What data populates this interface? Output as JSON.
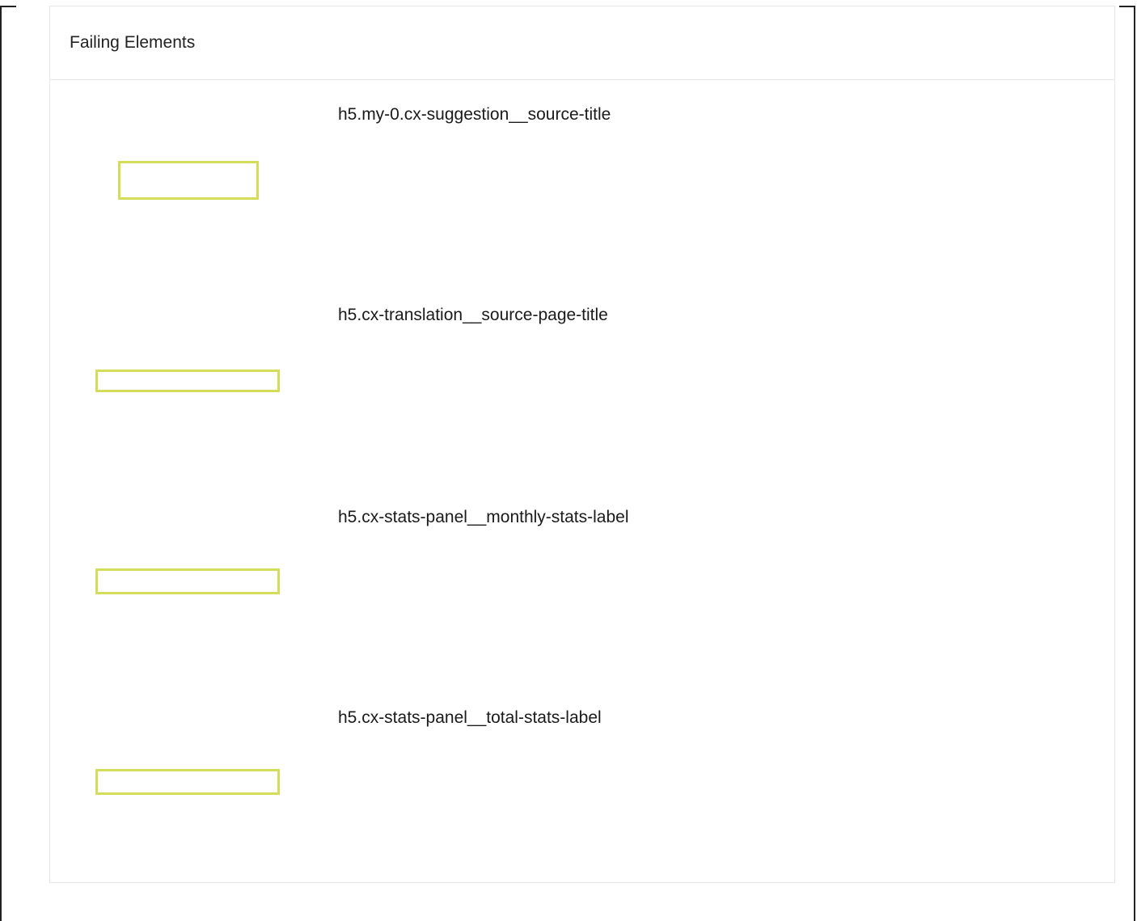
{
  "panel": {
    "title": "Failing Elements"
  },
  "elements": [
    {
      "selector": "h5.my-0.cx-suggestion__source-title"
    },
    {
      "selector": "h5.cx-translation__source-page-title"
    },
    {
      "selector": "h5.cx-stats-panel__monthly-stats-label"
    },
    {
      "selector": "h5.cx-stats-panel__total-stats-label"
    }
  ],
  "colors": {
    "highlight": "#d4dd5a",
    "border": "#e6e6e6",
    "text": "#222222"
  }
}
